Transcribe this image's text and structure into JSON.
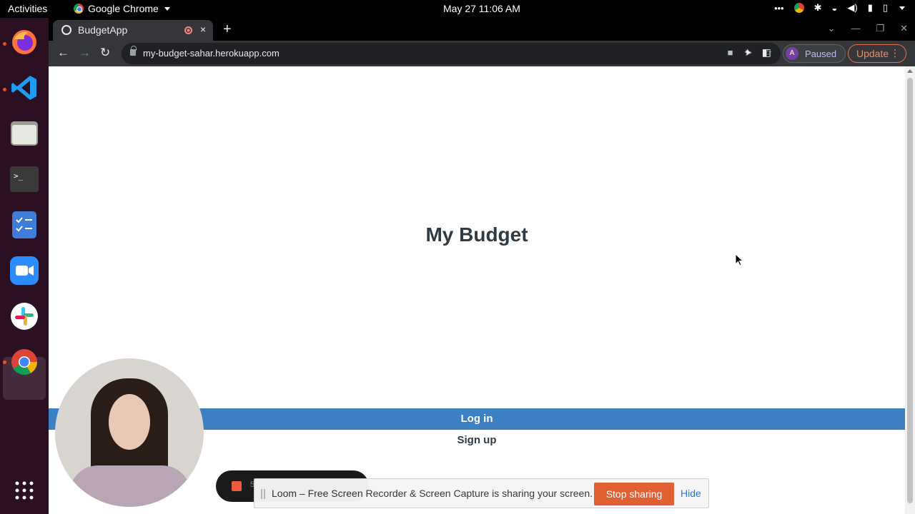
{
  "topbar": {
    "activities": "Activities",
    "app_name": "Google Chrome",
    "clock": "May 27  11:06 AM"
  },
  "dock": {
    "items": [
      "firefox",
      "vscode",
      "files",
      "terminal",
      "tasks",
      "zoom",
      "slack",
      "chrome",
      "app-grid"
    ]
  },
  "browser": {
    "tab_title": "BudgetApp",
    "tab_close": "×",
    "new_tab": "+",
    "url": "my-budget-sahar.herokuapp.com",
    "profile_initial": "A",
    "profile_status": "Paused",
    "update_label": "Update",
    "menu_dots": "⋮"
  },
  "page": {
    "title": "My Budget",
    "login_label": "Log in",
    "signup_label": "Sign up"
  },
  "loom": {
    "timer": "5:00"
  },
  "share_bar": {
    "message": "Loom – Free Screen Recorder & Screen Capture is sharing your screen.",
    "stop_label": "Stop sharing",
    "hide_label": "Hide"
  },
  "colors": {
    "login_bg": "#3c80c2",
    "dock_bg": "#2b0f22",
    "stop_bg": "#e15b2d",
    "title_text": "#2f3b45"
  }
}
